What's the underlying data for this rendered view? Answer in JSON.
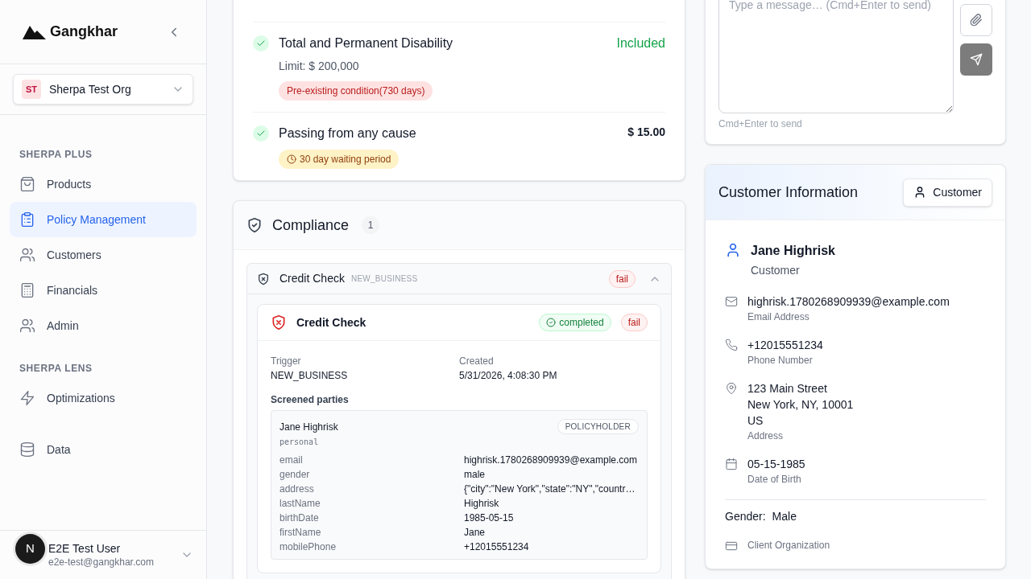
{
  "sidebar": {
    "logo": "Gangkhar",
    "org": {
      "initials": "ST",
      "name": "Sherpa Test Org"
    },
    "sections": [
      {
        "title": "SHERPA PLUS",
        "items": [
          {
            "label": "Products",
            "kind": "bag",
            "selected": false
          },
          {
            "label": "Policy Management",
            "kind": "clipboard",
            "selected": true
          },
          {
            "label": "Customers",
            "kind": "users",
            "selected": false
          },
          {
            "label": "Financials",
            "kind": "calculator",
            "selected": false
          },
          {
            "label": "Admin",
            "kind": "users",
            "selected": false
          }
        ]
      },
      {
        "title": "SHERPA LENS",
        "items": [
          {
            "label": "Optimizations",
            "kind": "bolt",
            "selected": false
          }
        ]
      },
      {
        "items": [
          {
            "label": "Data",
            "kind": "database",
            "selected": false
          }
        ]
      }
    ],
    "user": {
      "name": "E2E Test User",
      "email": "e2e-test@gangkhar.com"
    },
    "dev_badge": "N"
  },
  "coverages": [
    {
      "name": "Total and Permanent Disability",
      "limit": "Limit: $ 200,000",
      "value": "Included",
      "kind": "included",
      "badges": [
        {
          "text": "Pre-existing condition(730 days)",
          "kind": "exclusion"
        }
      ]
    },
    {
      "name": "Passing from any cause",
      "value": "$ 15.00",
      "kind": "price",
      "badges": [
        {
          "text": "30 day waiting period",
          "kind": "waiting"
        }
      ]
    }
  ],
  "compliance": {
    "title": "Compliance",
    "count": "1",
    "checks": [
      {
        "name": "Credit Check",
        "trigger_tag": "NEW_BUSINESS",
        "result": "fail",
        "expanded": true,
        "detail": {
          "title": "Credit Check",
          "status": "completed",
          "result": "fail",
          "trigger_label": "Trigger",
          "trigger": "NEW_BUSINESS",
          "created_label": "Created",
          "created": "5/31/2026, 4:08:30 PM",
          "screened_label": "Screened parties",
          "parties": [
            {
              "name": "Jane Highrisk",
              "role": "POLICYHOLDER",
              "type": "personal",
              "fields": [
                {
                  "key": "email",
                  "value": "highrisk.1780268909939@example.com"
                },
                {
                  "key": "gender",
                  "value": "male"
                },
                {
                  "key": "address",
                  "value": "{\"city\":\"New York\",\"state\":\"NY\",\"countr…"
                },
                {
                  "key": "lastName",
                  "value": "Highrisk"
                },
                {
                  "key": "birthDate",
                  "value": "1985-05-15"
                },
                {
                  "key": "firstName",
                  "value": "Jane"
                },
                {
                  "key": "mobilePhone",
                  "value": "+12015551234"
                }
              ]
            }
          ]
        }
      }
    ]
  },
  "message": {
    "placeholder": "Type a message… (Cmd+Enter to send)",
    "hint": "Cmd+Enter to send"
  },
  "customer": {
    "title": "Customer Information",
    "button": "Customer",
    "name": "Jane Highrisk",
    "role": "Customer",
    "contacts": [
      {
        "kind": "email",
        "lines": [
          "highrisk.1780268909939@example.com"
        ],
        "label": "Email Address"
      },
      {
        "kind": "phone",
        "lines": [
          "+12015551234"
        ],
        "label": "Phone Number"
      },
      {
        "kind": "address",
        "lines": [
          "123 Main Street",
          "New York, NY, 10001",
          "US"
        ],
        "label": "Address"
      },
      {
        "kind": "birth",
        "lines": [
          "05-15-1985"
        ],
        "label": "Date of Birth"
      }
    ],
    "gender_label": "Gender:",
    "gender": "Male",
    "org_label": "Client Organization"
  }
}
